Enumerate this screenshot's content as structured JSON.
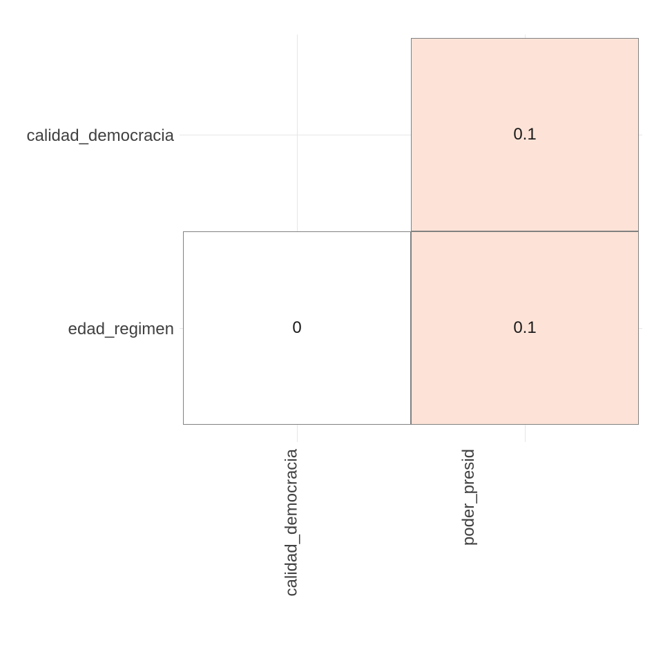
{
  "chart_data": {
    "type": "heatmap",
    "x_categories": [
      "calidad_democracia",
      "poder_presid"
    ],
    "y_categories": [
      "calidad_democracia",
      "edad_regimen"
    ],
    "matrix": [
      [
        null,
        0.1
      ],
      [
        0,
        0.1
      ]
    ],
    "color_scale": {
      "0": "#ffffff",
      "0.1": "#fde3d7"
    },
    "title": "",
    "xlabel": "",
    "ylabel": ""
  },
  "cells": {
    "top_right": "0.1",
    "bottom_left": "0",
    "bottom_right": "0.1"
  },
  "y_labels": {
    "top": "calidad_democracia",
    "bottom": "edad_regimen"
  },
  "x_labels": {
    "left": "calidad_democracia",
    "right": "poder_presid"
  }
}
